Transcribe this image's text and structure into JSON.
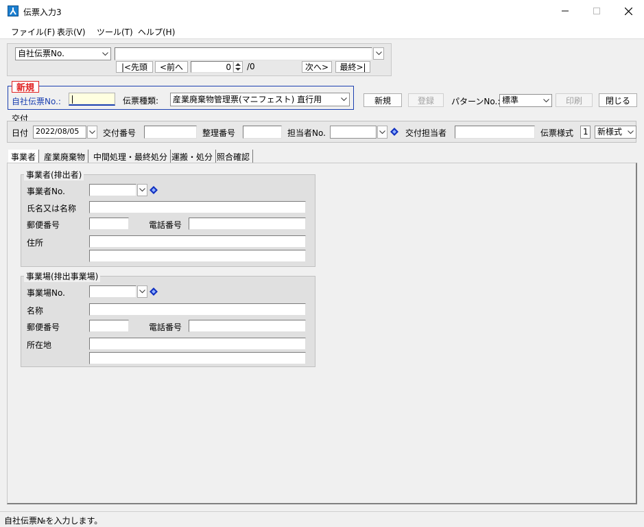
{
  "window": {
    "title": "伝票入力3"
  },
  "menu": [
    "ファイル(F)",
    "表示(V)",
    "ツール(T)",
    "ヘルプ(H)"
  ],
  "nav": {
    "key_select": "自社伝票No.",
    "search_value": "",
    "first": "|<先頭",
    "prev": "<前へ",
    "counter": "0",
    "total": "/0",
    "next": "次へ>",
    "last": "最終>|"
  },
  "mode": {
    "badge": "新規",
    "slip_no_label": "自社伝票No.:",
    "slip_no_value": "",
    "slip_type_label": "伝票種類:",
    "slip_type_value": "産業廃棄物管理票(マニフェスト) 直行用"
  },
  "actions": {
    "new": "新規",
    "register": "登録",
    "pattern_label": "パターンNo.:",
    "pattern_value": "標準",
    "print": "印刷",
    "close": "閉じる"
  },
  "issue": {
    "section": "交付",
    "date_label": "日付",
    "date_value": "2022/08/05",
    "issue_no_label": "交付番号",
    "issue_no_value": "",
    "ref_no_label": "整理番号",
    "ref_no_value": "",
    "staff_no_label": "担当者No.",
    "staff_no_value": "",
    "issuer_label": "交付担当者",
    "issuer_value": "",
    "format_label": "伝票様式",
    "format_no": "1",
    "format_value": "新様式"
  },
  "tabs": [
    "事業者",
    "産業廃棄物",
    "中間処理・最終処分",
    "運搬・処分",
    "照合確認"
  ],
  "business": {
    "title": "事業者(排出者)",
    "no_label": "事業者No.",
    "name_label": "氏名又は名称",
    "zip_label": "郵便番号",
    "tel_label": "電話番号",
    "address_label": "住所"
  },
  "site": {
    "title": "事業場(排出事業場)",
    "no_label": "事業場No.",
    "name_label": "名称",
    "zip_label": "郵便番号",
    "tel_label": "電話番号",
    "address_label": "所在地"
  },
  "status": {
    "text": "自社伝票№を入力します。"
  },
  "colors": {
    "accent": "#1a3fb0",
    "badge_red": "#e02020",
    "focus_field": "#ffffe0"
  }
}
